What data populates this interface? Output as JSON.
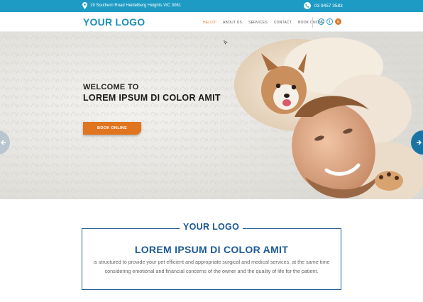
{
  "topbar": {
    "address": "19 Southern Road Heidelberg Heights VIC 3081",
    "phone": "03 9457 3583"
  },
  "header": {
    "logo": "YOUR LOGO",
    "nav": [
      {
        "label": "HELLO!",
        "active": true
      },
      {
        "label": "ABOUT US",
        "active": false
      },
      {
        "label": "SERVICES",
        "active": false
      },
      {
        "label": "CONTACT",
        "active": false
      },
      {
        "label": "BOOK ONLINE",
        "active": false
      }
    ],
    "social": [
      {
        "icon": "facebook-icon",
        "glyph": "f"
      },
      {
        "icon": "twitter-icon",
        "glyph": "t"
      },
      {
        "icon": "instagram-icon",
        "glyph": "o"
      }
    ]
  },
  "hero": {
    "welcome": "WELCOME TO",
    "title": "LOREM IPSUM DI COLOR AMIT",
    "button": "BOOK ONLINE",
    "slides": 3,
    "active_slide": 2
  },
  "intro": {
    "logo": "YOUR LOGO",
    "title": "LOREM IPSUM DI COLOR AMIT",
    "text": "is structured to provide your pet efficient and appropriate surgical and medical services, at the same time considering emotional and financial concerns of the owner and the quality of life for the patient."
  },
  "colors": {
    "primary": "#1d9bc4",
    "accent": "#e0741f",
    "dark_blue": "#1d5a99",
    "arrow_right": "#1a73a3"
  }
}
